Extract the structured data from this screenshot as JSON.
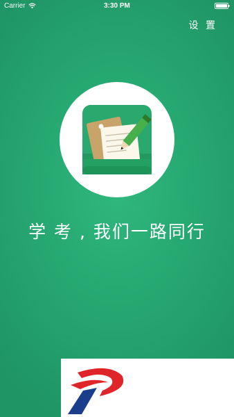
{
  "status_bar": {
    "carrier": "Carrier",
    "time": "3:30 PM",
    "wifi_icon": "wifi-icon",
    "battery_icon": "battery-icon"
  },
  "header": {
    "settings_label": "设 置"
  },
  "splash": {
    "logo_icon": "notepad-pencil-icon",
    "slogan": "学 考 , 我们一路同行"
  },
  "brand": {
    "logo_icon": "brand-p-logo"
  },
  "colors": {
    "background": "#26a871",
    "icon_green": "#2aa96e",
    "brand_red": "#e0252a",
    "brand_blue": "#1a3e8c"
  }
}
